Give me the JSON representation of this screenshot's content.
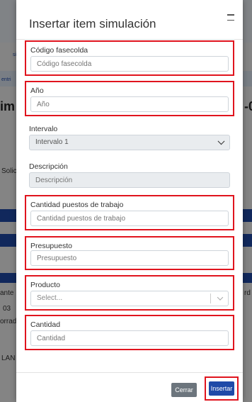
{
  "modal": {
    "title": "Insertar item simulación",
    "fields": {
      "codigo": {
        "label": "Código fasecolda",
        "placeholder": "Código fasecolda"
      },
      "anio": {
        "label": "Año",
        "placeholder": "Año"
      },
      "intervalo": {
        "label": "Intervalo",
        "value": "Intervalo 1"
      },
      "descripcion": {
        "label": "Descripción",
        "placeholder": "Descripción"
      },
      "cantidad_puestos": {
        "label": "Cantidad puestos de trabajo",
        "placeholder": "Cantidad puestos de trabajo"
      },
      "presupuesto": {
        "label": "Presupuesto",
        "placeholder": "Presupuesto"
      },
      "producto": {
        "label": "Producto",
        "value": "Select..."
      },
      "cantidad": {
        "label": "Cantidad",
        "placeholder": "Cantidad"
      }
    },
    "buttons": {
      "cerrar": "Cerrar",
      "insertar": "Insertar"
    }
  },
  "background": {
    "title_fragment": "im",
    "title_fragment_right": "-0",
    "sidebar_left": [
      "si",
      "entri",
      "Solic",
      "ante",
      "03",
      "orrad",
      "LAN"
    ],
    "sidebar_right": [
      "rd"
    ]
  },
  "colors": {
    "highlight": "#e0141e",
    "primary": "#1f4aa8",
    "secondary": "#6c757d"
  }
}
